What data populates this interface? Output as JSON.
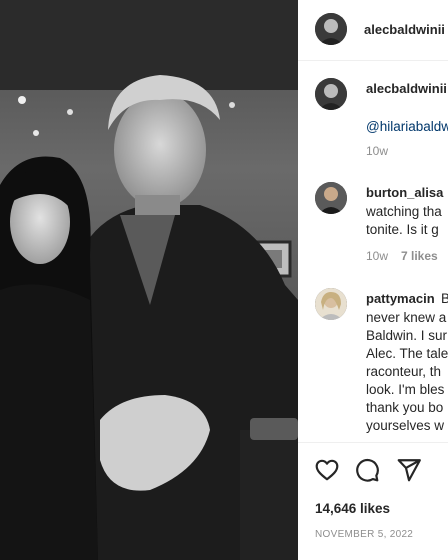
{
  "post": {
    "author": "alecbaldwinii",
    "image_alt": "Black and white photo of a couple"
  },
  "caption": {
    "author": "alecbaldwinii",
    "text": "@hilariabaldwin",
    "time": "10w"
  },
  "comments": [
    {
      "user": "burton_alisa",
      "lines": [
        "watching tha",
        "tonite. Is it g"
      ],
      "time": "10w",
      "likes": "7 likes"
    },
    {
      "user": "pattymacin",
      "lines": [
        "never knew a",
        "Baldwin. I sur",
        "Alec. The tale",
        "raconteur, th",
        "look. I'm bles",
        "thank you bo",
        "yourselves w"
      ],
      "first_word": "B"
    }
  ],
  "actions": {
    "icons": [
      "heart-icon",
      "comment-icon",
      "share-icon"
    ],
    "likes": "14,646 likes",
    "date": "NOVEMBER 5, 2022"
  }
}
